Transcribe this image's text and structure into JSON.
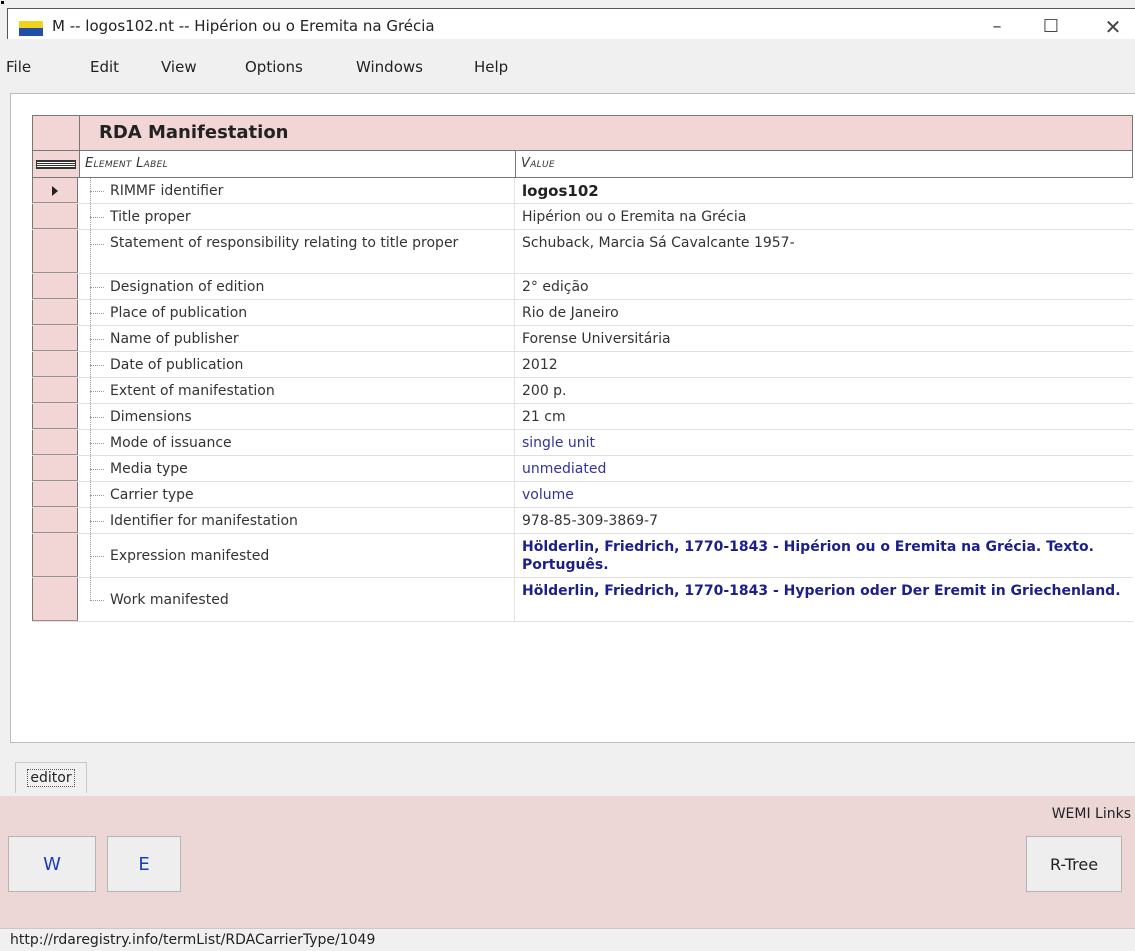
{
  "window": {
    "title": "M  --  logos102.nt  --  Hipérion ou o Eremita na Grécia",
    "minimize": "–",
    "maximize": "☐",
    "close": "✕"
  },
  "menu": {
    "items": [
      "File",
      "Edit",
      "View",
      "Options",
      "Windows",
      "Help"
    ]
  },
  "record": {
    "title": "RDA Manifestation",
    "col_label": "Element Label",
    "col_value": "Value",
    "rows": [
      {
        "label": "RIMMF identifier",
        "value": "logos102"
      },
      {
        "label": "Title proper",
        "value": "Hipérion ou o Eremita na Grécia"
      },
      {
        "label": "Statement of responsibility relating to title proper",
        "value": "Schuback, Marcia Sá Cavalcante 1957-"
      },
      {
        "label": "Designation of edition",
        "value": "2° edição"
      },
      {
        "label": "Place of publication",
        "value": "Rio de Janeiro"
      },
      {
        "label": "Name of publisher",
        "value": "Forense Universitária"
      },
      {
        "label": "Date of publication",
        "value": "2012"
      },
      {
        "label": "Extent of manifestation",
        "value": "200 p."
      },
      {
        "label": "Dimensions",
        "value": "21 cm"
      },
      {
        "label": "Mode of issuance",
        "value": "single unit"
      },
      {
        "label": "Media type",
        "value": "unmediated"
      },
      {
        "label": "Carrier type",
        "value": "volume"
      },
      {
        "label": "Identifier for manifestation",
        "value": "978-85-309-3869-7"
      },
      {
        "label": "Expression manifested",
        "value": "Hölderlin, Friedrich, 1770-1843 - Hipérion ou o Eremita na Grécia. Texto. Português."
      },
      {
        "label": "Work manifested",
        "value": "Hölderlin, Friedrich, 1770-1843 - Hyperion oder Der Eremit in Griechenland."
      }
    ]
  },
  "tabs": {
    "editor": "editor"
  },
  "wemi": {
    "title": "WEMI Links",
    "w_button": "W",
    "e_button": "E",
    "rtree_button": "R-Tree"
  },
  "status": {
    "url": "http://rdaregistry.info/termList/RDACarrierType/1049"
  },
  "colors": {
    "pink": "#f2d6d6",
    "link": "#333399",
    "panel": "#ecd6d6"
  }
}
